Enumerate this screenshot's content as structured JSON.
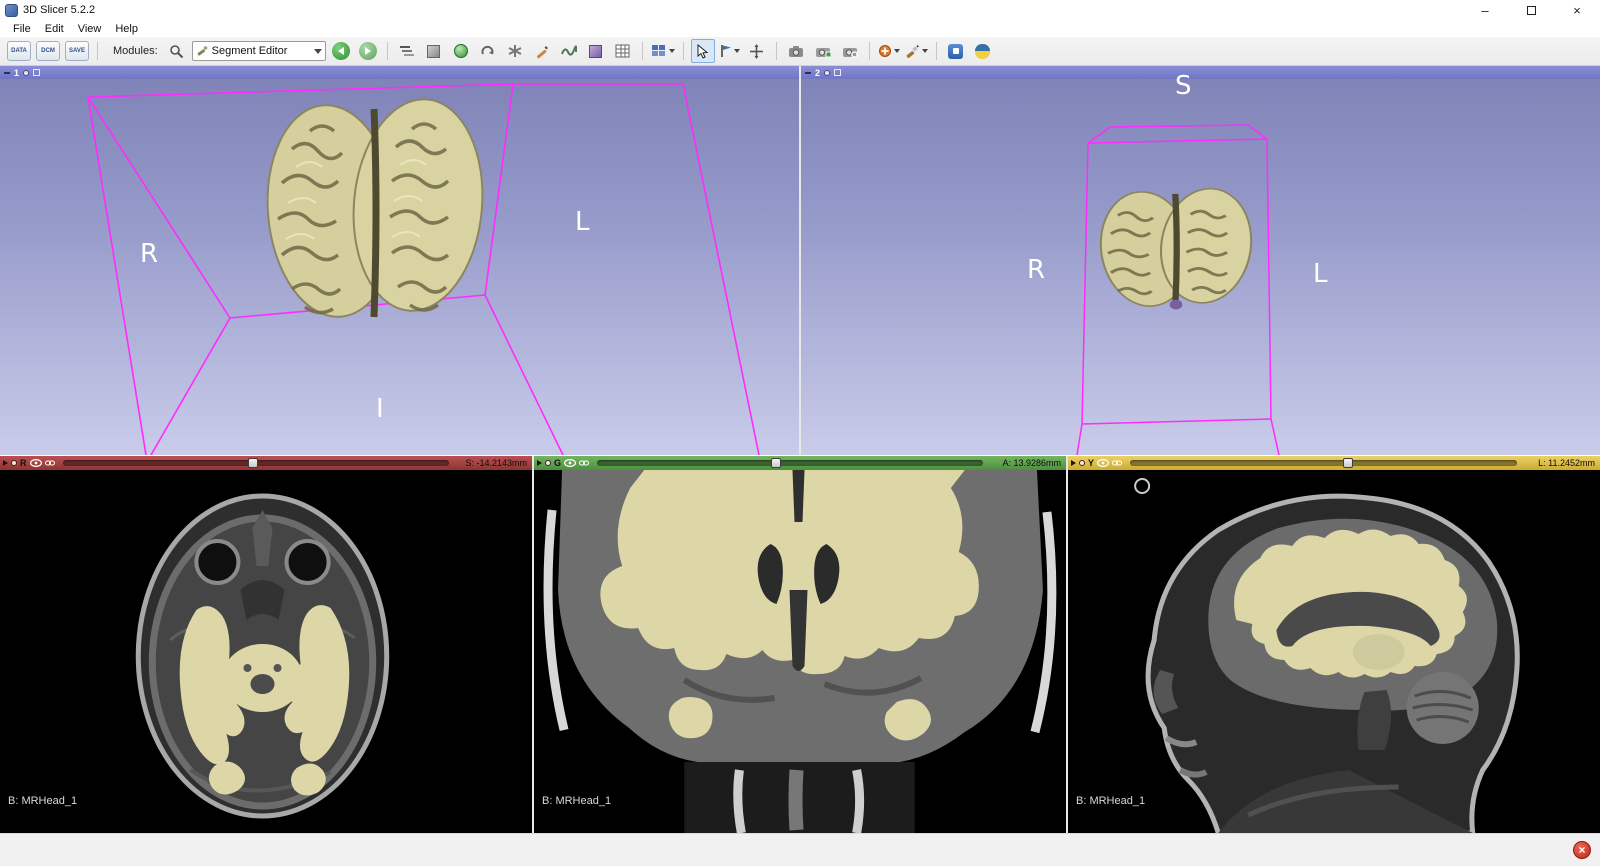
{
  "window": {
    "title": "3D Slicer 5.2.2",
    "controls": {
      "minimize": "minimize-button",
      "maximize": "maximize-button",
      "close": "close-button"
    }
  },
  "menubar": {
    "items": [
      {
        "label": "File"
      },
      {
        "label": "Edit"
      },
      {
        "label": "View"
      },
      {
        "label": "Help"
      }
    ]
  },
  "toolbar": {
    "load_data_label": "DATA",
    "load_dicom_label": "DCM",
    "save_label": "SAVE",
    "modules_label": "Modules:",
    "module_selected": "Segment Editor",
    "icons": [
      "module-search-icon",
      "module-history-back-icon",
      "module-history-forward-icon",
      "module-shortcut-data-icon",
      "module-shortcut-volumes-icon",
      "module-shortcut-models-icon",
      "module-shortcut-transforms-icon",
      "module-shortcut-annotations-icon",
      "module-shortcut-editor-icon",
      "module-shortcut-volume-rendering-icon",
      "module-shortcut-segmentations-icon",
      "module-shortcut-tables-icon",
      "layout-selector-icon",
      "mouse-pointer-icon",
      "place-point-icon",
      "adjust-crosshair-icon",
      "screenshot-icon",
      "scene-view-capture-icon",
      "scene-view-restore-icon",
      "markups-place-icon",
      "paint-tools-icon",
      "extensions-manager-icon",
      "python-console-icon"
    ]
  },
  "views3d": [
    {
      "id": "1",
      "labels": {
        "left": "R",
        "right": "L",
        "bottom": "I"
      }
    },
    {
      "id": "2",
      "labels": {
        "top": "S",
        "left": "R",
        "right": "L"
      }
    }
  ],
  "slices": [
    {
      "name": "Red",
      "letter": "R",
      "offset": "S: -14.2143mm",
      "volume": "B: MRHead_1",
      "color": "#a84444",
      "slider_fraction": 0.48
    },
    {
      "name": "Green",
      "letter": "G",
      "offset": "A: 13.9286mm",
      "volume": "B: MRHead_1",
      "color": "#5fa551",
      "slider_fraction": 0.45
    },
    {
      "name": "Yellow",
      "letter": "Y",
      "offset": "L: 11.2452mm",
      "volume": "B: MRHead_1",
      "color": "#e0c44f",
      "slider_fraction": 0.55
    }
  ],
  "colors": {
    "bg3d_top": "#7f83b7",
    "bg3d_bottom": "#c9cce9",
    "roi_wireframe": "#ff2bff",
    "brain_surface": "#d8d2a0",
    "segmentation": "#ddd7a8"
  },
  "statusbar": {
    "error_button": "×"
  }
}
